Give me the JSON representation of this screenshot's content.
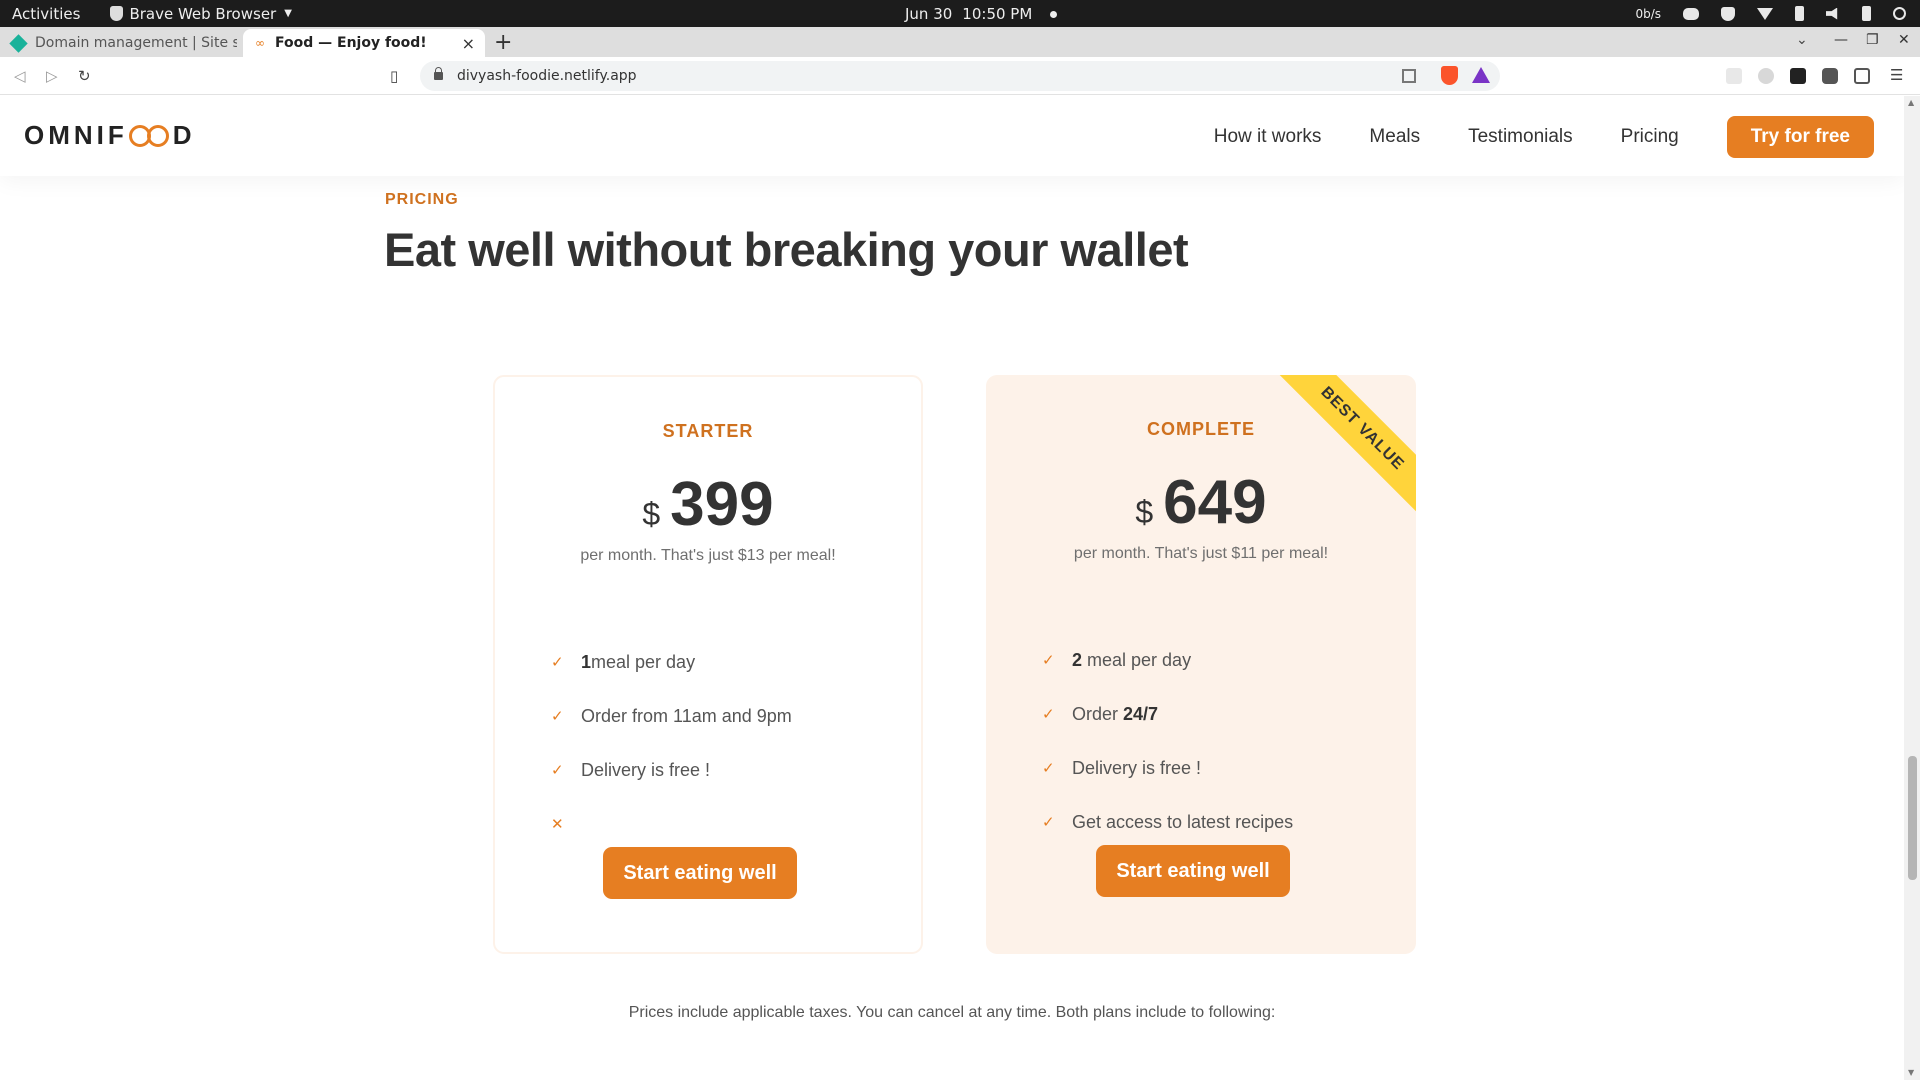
{
  "os_bar": {
    "activities": "Activities",
    "app_name": "Brave Web Browser",
    "date": "Jun 30",
    "time": "10:50 PM",
    "net_speed": "0b/s"
  },
  "browser": {
    "tabs": [
      {
        "title": "Domain management | Site se"
      },
      {
        "title": "Food — Enjoy food!"
      }
    ],
    "url": "divyash-foodie.netlify.app"
  },
  "site": {
    "logo": {
      "before": "OMNIF",
      "after": "D"
    },
    "nav": [
      {
        "label": "How it works"
      },
      {
        "label": "Meals"
      },
      {
        "label": "Testimonials"
      },
      {
        "label": "Pricing"
      }
    ],
    "cta": "Try for free",
    "pricing": {
      "subheading": "PRICING",
      "heading": "Eat well without breaking your wallet",
      "plans": [
        {
          "name": "STARTER",
          "currency": "$",
          "price": "399",
          "note": "per month. That's just $13 per meal!",
          "features": [
            {
              "bold": "1",
              "text": "meal per day",
              "icon": "check"
            },
            {
              "bold": "",
              "text": "Order from 11am and 9pm",
              "icon": "check"
            },
            {
              "bold": "",
              "text": "Delivery is free !",
              "icon": "check"
            },
            {
              "bold": "",
              "text": "",
              "icon": "close"
            }
          ],
          "button": "Start eating well"
        },
        {
          "name": "COMPLETE",
          "currency": "$",
          "price": "649",
          "note": "per month. That's just $11 per meal!",
          "ribbon": "BEST VALUE",
          "features": [
            {
              "bold": "2",
              "text": " meal per day",
              "icon": "check"
            },
            {
              "bold": "24/7",
              "text": "Order ",
              "icon": "check"
            },
            {
              "bold": "",
              "text": "Delivery is free !",
              "icon": "check"
            },
            {
              "bold": "",
              "text": "Get access to latest recipes",
              "icon": "check"
            }
          ],
          "button": "Start eating well"
        }
      ],
      "footnote": "Prices include applicable taxes. You can cancel at any time. Both plans include to following:"
    }
  },
  "colors": {
    "accent": "#e67e22",
    "accent_dark": "#cf711f",
    "tint": "#fdf2e9",
    "ribbon": "#ffd43b",
    "text": "#333333"
  }
}
